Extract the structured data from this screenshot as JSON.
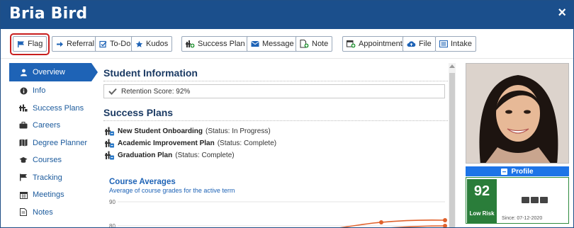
{
  "header": {
    "title": "Bria Bird",
    "close_icon": "×"
  },
  "toolbar": {
    "flag": "Flag",
    "referral": "Referral",
    "todo": "To-Do",
    "kudos": "Kudos",
    "success_plan": "Success Plan",
    "message": "Message",
    "note": "Note",
    "appointment": "Appointment",
    "file": "File",
    "intake": "Intake"
  },
  "sidebar": {
    "items": [
      {
        "label": "Overview",
        "icon": "person-icon",
        "active": true
      },
      {
        "label": "Info",
        "icon": "info-icon"
      },
      {
        "label": "Success Plans",
        "icon": "success-plan-icon"
      },
      {
        "label": "Careers",
        "icon": "briefcase-icon"
      },
      {
        "label": "Degree Planner",
        "icon": "map-icon"
      },
      {
        "label": "Courses",
        "icon": "graduation-cap-icon"
      },
      {
        "label": "Tracking",
        "icon": "flag-icon"
      },
      {
        "label": "Meetings",
        "icon": "calendar-icon"
      },
      {
        "label": "Notes",
        "icon": "note-icon"
      }
    ]
  },
  "main": {
    "student_info_heading": "Student Information",
    "retention": "Retention Score: 92%",
    "success_plans_heading": "Success Plans",
    "plans": [
      {
        "name": "New Student Onboarding",
        "status": " (Status: In Progress)"
      },
      {
        "name": "Academic Improvement Plan",
        "status": " (Status: Complete)"
      },
      {
        "name": "Graduation Plan",
        "status": " (Status: Complete)"
      }
    ],
    "course_averages_title": "Course Averages",
    "course_averages_subtitle": "Average of course grades for the active term"
  },
  "chart_data": {
    "type": "line",
    "title": "Course Averages",
    "subtitle": "Average of course grades for the active term",
    "ytick_labels": [
      "90",
      "80"
    ],
    "ylim": [
      80,
      90
    ],
    "series_color": "#e0602a"
  },
  "profile": {
    "button_label": "Profile",
    "score": "92",
    "risk_label": "Low Risk",
    "since": "Since: 07-12-2020"
  },
  "colors": {
    "header_bg": "#1b4f8c",
    "accent_blue": "#1e63b6",
    "risk_green": "#2a7d3a",
    "highlight_red": "#c81e1e"
  }
}
